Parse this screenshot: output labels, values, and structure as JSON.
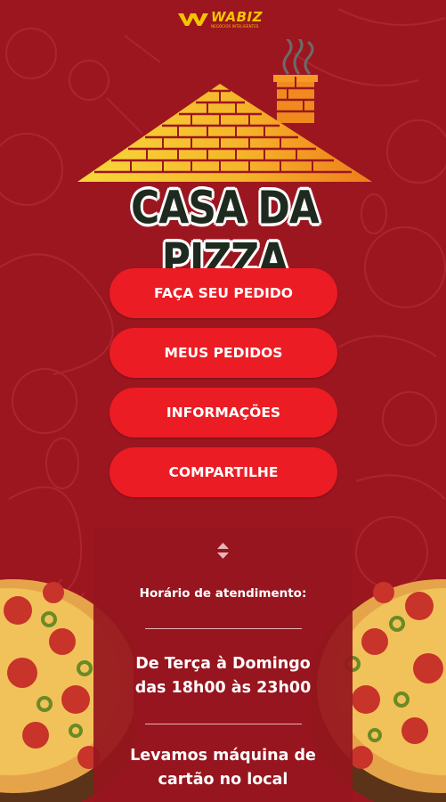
{
  "brand": {
    "name": "WABIZ",
    "tagline": "NEGÓCIOS INTELIGENTES"
  },
  "logo": {
    "title": "CASA DA PIZZA"
  },
  "menu": {
    "items": [
      {
        "label": "FAÇA SEU PEDIDO"
      },
      {
        "label": "MEUS PEDIDOS"
      },
      {
        "label": "INFORMAÇÕES"
      },
      {
        "label": "COMPARTILHE"
      }
    ]
  },
  "info": {
    "schedule_label": "Horário de atendimento:",
    "hours_line1": "De Terça à Domingo",
    "hours_line2": "das 18h00 às 23h00",
    "card_line1": "Levamos máquina de",
    "card_line2": "cartão no local"
  },
  "colors": {
    "background": "#9c1620",
    "button": "#ec1c24",
    "brand_yellow": "#f5c400",
    "roof_gradient": [
      "#f7d437",
      "#f18d1e"
    ]
  },
  "icons": {
    "expand": "expand-updown-icon",
    "brand": "wabiz-logo-icon",
    "house": "house-roof-icon",
    "smoke": "chimney-smoke-icon"
  }
}
